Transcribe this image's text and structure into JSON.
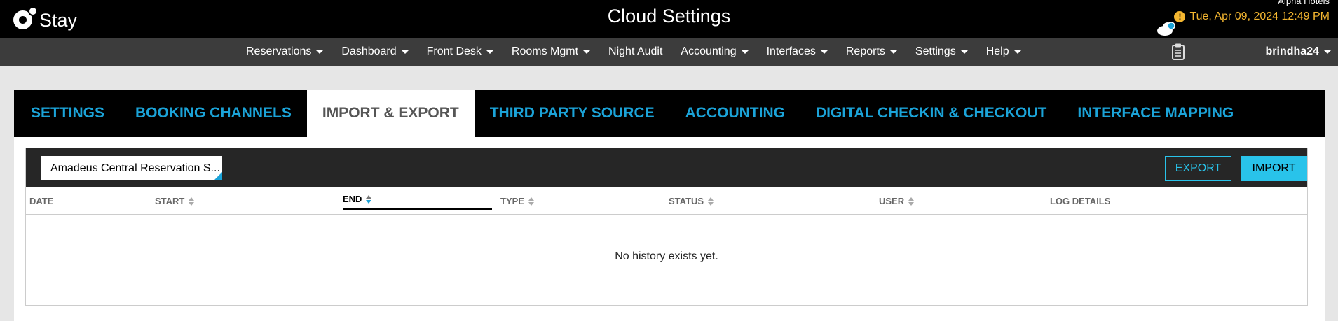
{
  "header": {
    "logo_text": "Stay",
    "title": "Cloud Settings",
    "hotel_name": "Alpha Hotels",
    "datetime": "Tue, Apr 09, 2024 12:49 PM",
    "warning_glyph": "!"
  },
  "nav": {
    "items": [
      {
        "label": "Reservations",
        "dropdown": true
      },
      {
        "label": "Dashboard",
        "dropdown": true
      },
      {
        "label": "Front Desk",
        "dropdown": true
      },
      {
        "label": "Rooms Mgmt",
        "dropdown": true
      },
      {
        "label": "Night Audit",
        "dropdown": false
      },
      {
        "label": "Accounting",
        "dropdown": true
      },
      {
        "label": "Interfaces",
        "dropdown": true
      },
      {
        "label": "Reports",
        "dropdown": true
      },
      {
        "label": "Settings",
        "dropdown": true
      },
      {
        "label": "Help",
        "dropdown": true
      }
    ],
    "user": "brindha24"
  },
  "tabs": [
    {
      "label": "SETTINGS",
      "active": false
    },
    {
      "label": "BOOKING CHANNELS",
      "active": false
    },
    {
      "label": "IMPORT & EXPORT",
      "active": true
    },
    {
      "label": "THIRD PARTY SOURCE",
      "active": false
    },
    {
      "label": "ACCOUNTING",
      "active": false
    },
    {
      "label": "DIGITAL CHECKIN & CHECKOUT",
      "active": false
    },
    {
      "label": "INTERFACE MAPPING",
      "active": false
    }
  ],
  "panel": {
    "source_select": "Amadeus Central Reservation S...",
    "export_label": "EXPORT",
    "import_label": "IMPORT",
    "columns": {
      "date": "DATE",
      "start": "START",
      "end": "END",
      "type": "TYPE",
      "status": "STATUS",
      "user": "USER",
      "log_details": "LOG DETAILS"
    },
    "empty_message": "No history exists yet."
  },
  "colors": {
    "accent": "#1ba3d8",
    "button": "#29c3ea",
    "date_text": "#f4b630"
  }
}
